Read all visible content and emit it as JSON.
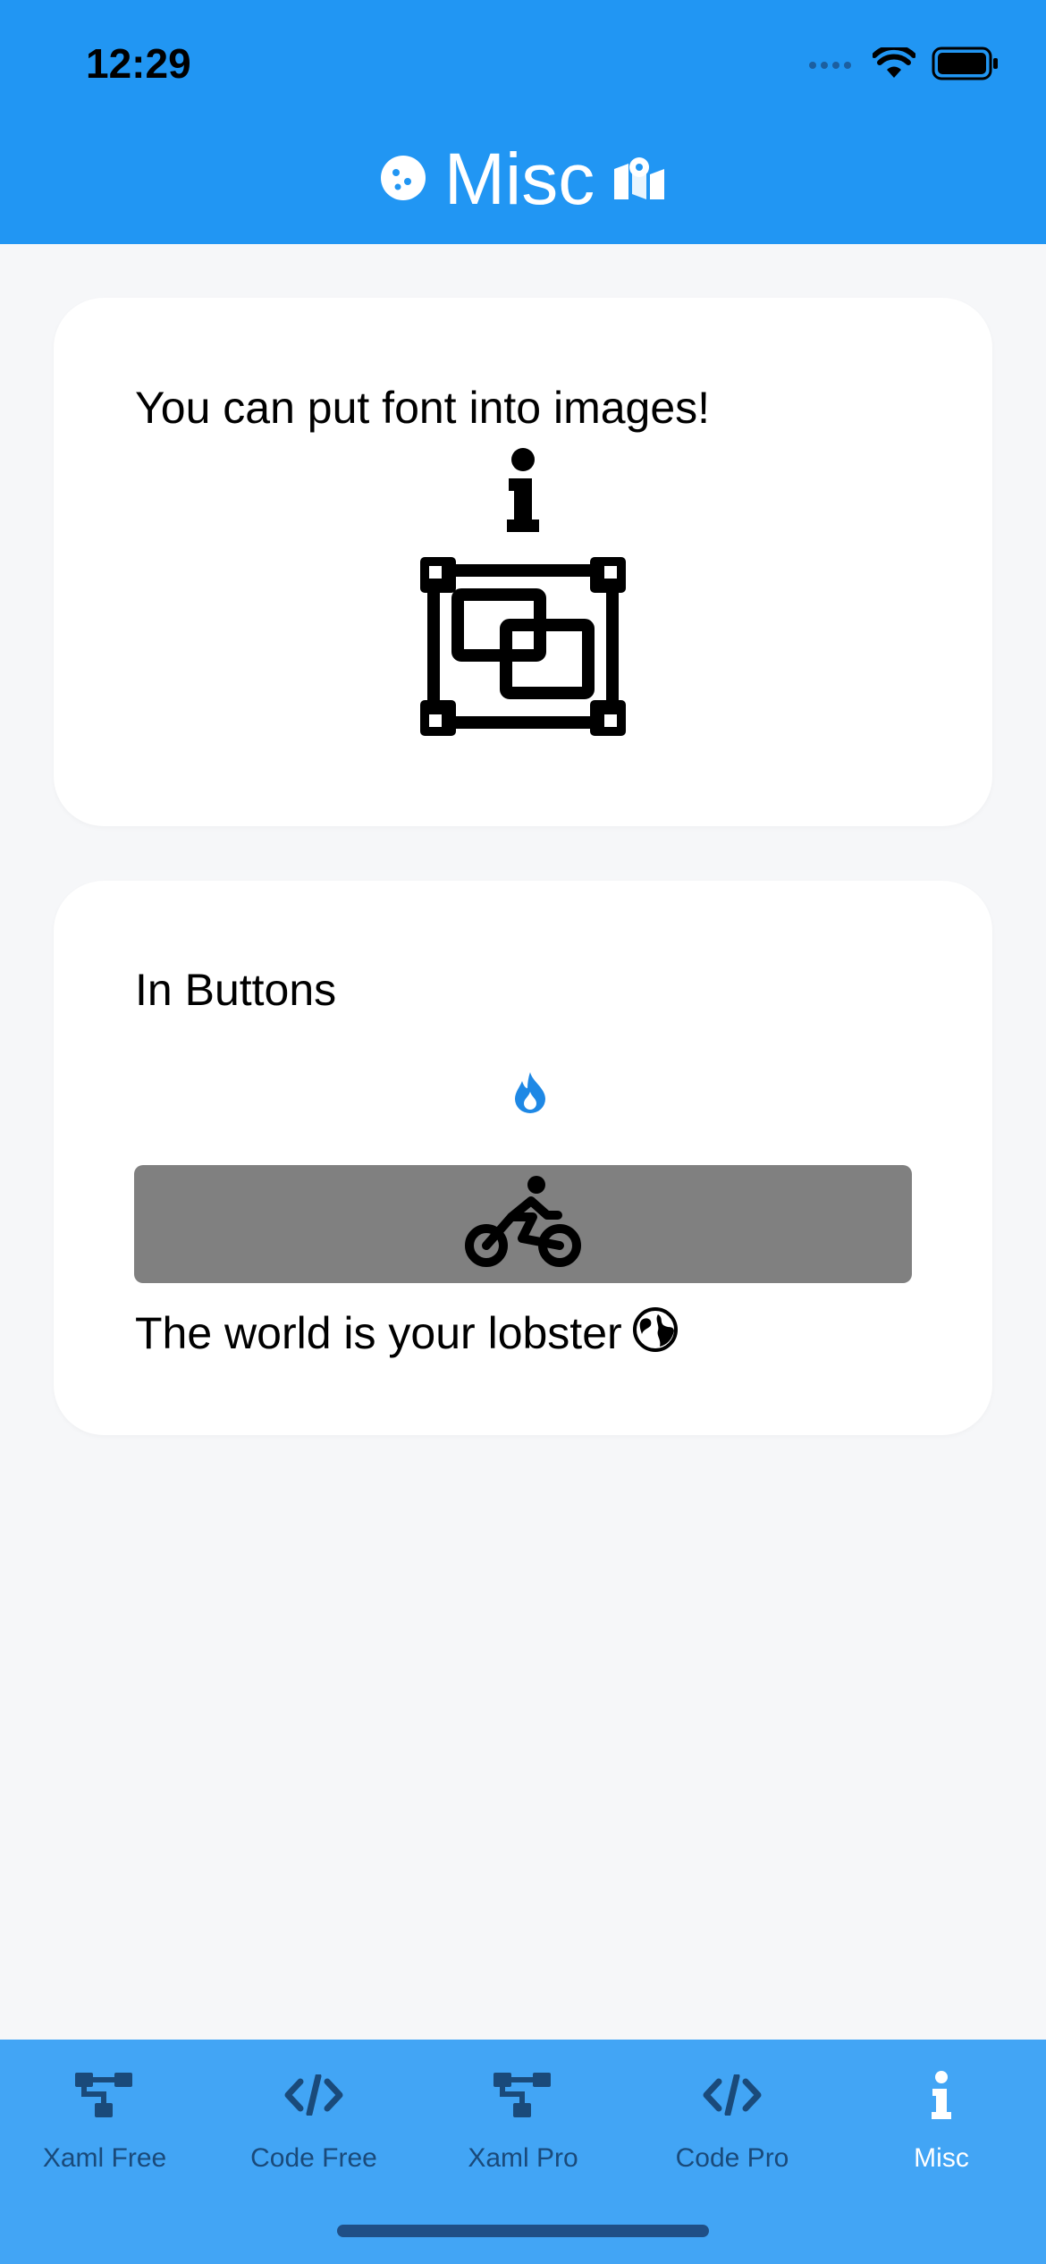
{
  "status_bar": {
    "time": "12:29"
  },
  "header": {
    "title": "Misc"
  },
  "card_images": {
    "text": "You can put font into images!"
  },
  "card_buttons": {
    "heading": "In Buttons",
    "caption": "The world is your lobster"
  },
  "tabs": [
    {
      "label": "Xaml Free",
      "icon": "hierarchy-icon",
      "active": false
    },
    {
      "label": "Code Free",
      "icon": "code-icon",
      "active": false
    },
    {
      "label": "Xaml Pro",
      "icon": "hierarchy-icon",
      "active": false
    },
    {
      "label": "Code Pro",
      "icon": "code-icon",
      "active": false
    },
    {
      "label": "Misc",
      "icon": "info-icon",
      "active": true
    }
  ],
  "colors": {
    "header": "#2196f3",
    "tabbar": "#42a5f5",
    "tab_inactive": "#1a4a7a",
    "tab_active": "#ffffff",
    "fire_icon": "#1e88e5",
    "button_bg": "#808080"
  }
}
